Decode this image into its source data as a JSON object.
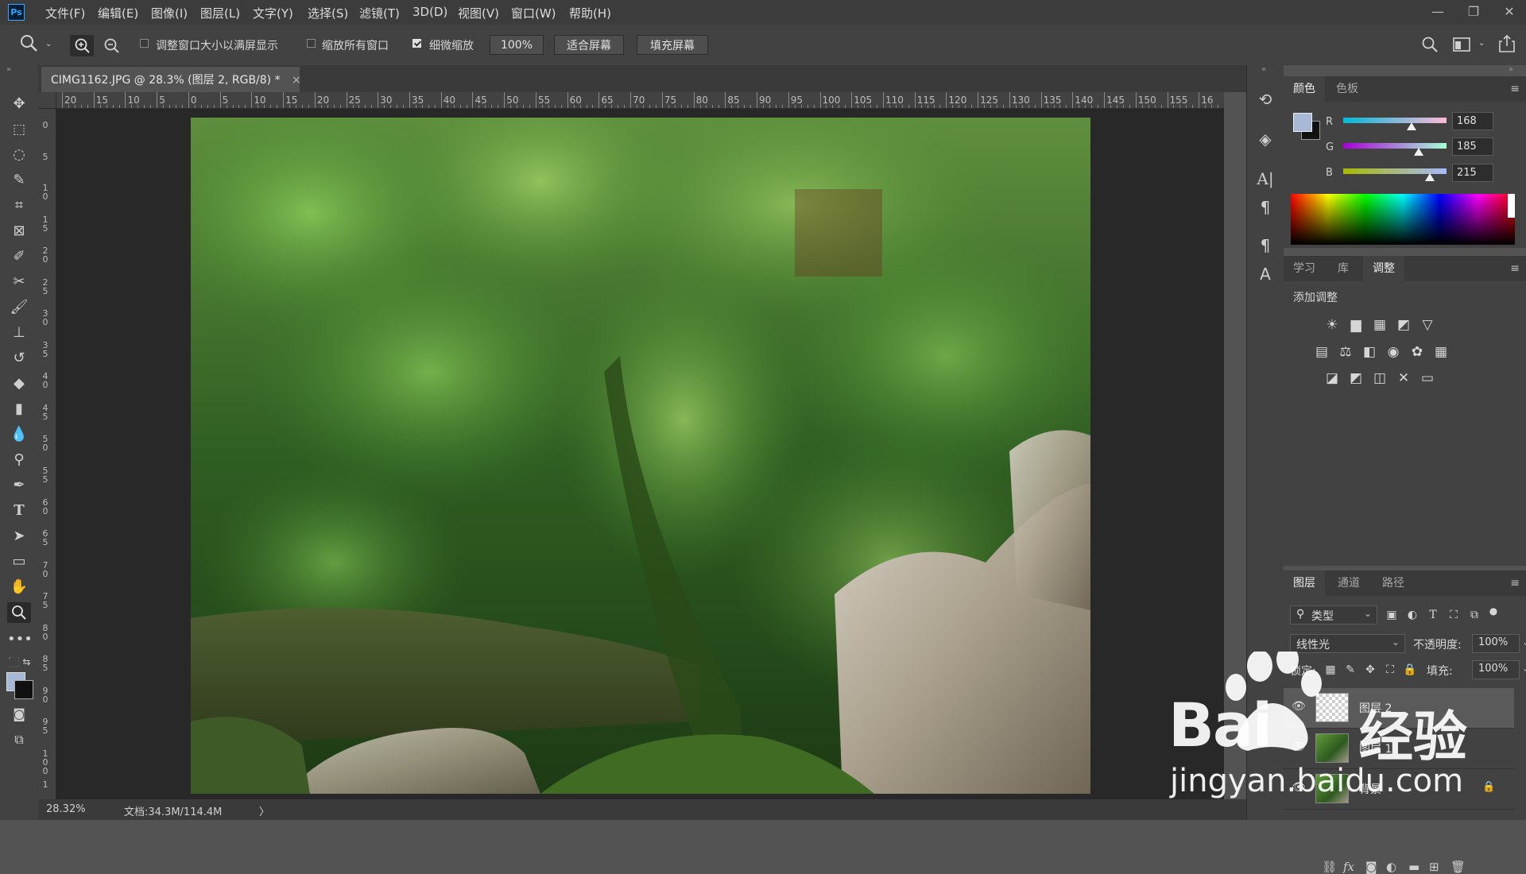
{
  "menubar": {
    "logo": "Ps",
    "items": [
      "文件(F)",
      "编辑(E)",
      "图像(I)",
      "图层(L)",
      "文字(Y)",
      "选择(S)",
      "滤镜(T)",
      "3D(D)",
      "视图(V)",
      "窗口(W)",
      "帮助(H)"
    ]
  },
  "options": {
    "resize_windows": "调整窗口大小以满屏显示",
    "zoom_all": "缩放所有窗口",
    "scrubby": "细微缩放",
    "zoom_value": "100%",
    "fit_screen": "适合屏幕",
    "fill_screen": "填充屏幕"
  },
  "document": {
    "tab_title": "CIMG1162.JPG @ 28.3% (图层 2, RGB/8) *",
    "close": "×"
  },
  "ruler": {
    "top_labels": [
      "20",
      "15",
      "10",
      "5",
      "0",
      "5",
      "10",
      "15",
      "20",
      "25",
      "30",
      "35",
      "40",
      "45",
      "50",
      "55",
      "60",
      "65",
      "70",
      "75",
      "80",
      "85",
      "90",
      "95",
      "100",
      "105",
      "110",
      "115",
      "120",
      "125",
      "130",
      "135",
      "140",
      "145",
      "150",
      "155",
      "16"
    ],
    "left_labels": [
      "0",
      "5",
      "1\n0",
      "1\n5",
      "2\n0",
      "2\n5",
      "3\n0",
      "3\n5",
      "4\n0",
      "4\n5",
      "5\n0",
      "5\n5",
      "6\n0",
      "6\n5",
      "7\n0",
      "7\n5",
      "8\n0",
      "8\n5",
      "9\n0",
      "9\n5",
      "1\n0\n0",
      "1"
    ]
  },
  "status": {
    "zoom": "28.32%",
    "doc": "文档:34.3M/114.4M",
    "arrow": "〉"
  },
  "color_panel": {
    "tabs": [
      "颜色",
      "色板"
    ],
    "active_tab": 0,
    "r_label": "R",
    "g_label": "G",
    "b_label": "B",
    "r": "168",
    "g": "185",
    "b": "215",
    "r_level": 0.66,
    "g_level": 0.73,
    "b_level": 0.84,
    "fg_color": "#a8b9d7",
    "bg_color": "#111111"
  },
  "adjust_panel": {
    "tabs": [
      "学习",
      "库",
      "调整"
    ],
    "active_tab": 2,
    "title": "添加调整",
    "row1": [
      "☀",
      "▆",
      "▦",
      "◩",
      "▽"
    ],
    "row2": [
      "▤",
      "⚖",
      "◧",
      "◉",
      "✿",
      "▦"
    ],
    "row3": [
      "◪",
      "◩",
      "◫",
      "✕",
      "▭"
    ]
  },
  "layers_panel": {
    "tabs": [
      "图层",
      "通道",
      "路径"
    ],
    "active_tab": 0,
    "filter": "类型",
    "blend_mode": "线性光",
    "opacity_label": "不透明度:",
    "opacity": "100%",
    "lock_label": "锁定:",
    "fill_label": "填充:",
    "fill": "100%",
    "layers": [
      {
        "name": "图层 2",
        "selected": true
      },
      {
        "name": "图层 1",
        "selected": false
      },
      {
        "name": "背景",
        "selected": false
      }
    ]
  },
  "watermark": {
    "brand": "Bai",
    "brand2": "经验",
    "url": "jingyan.baidu.com"
  }
}
